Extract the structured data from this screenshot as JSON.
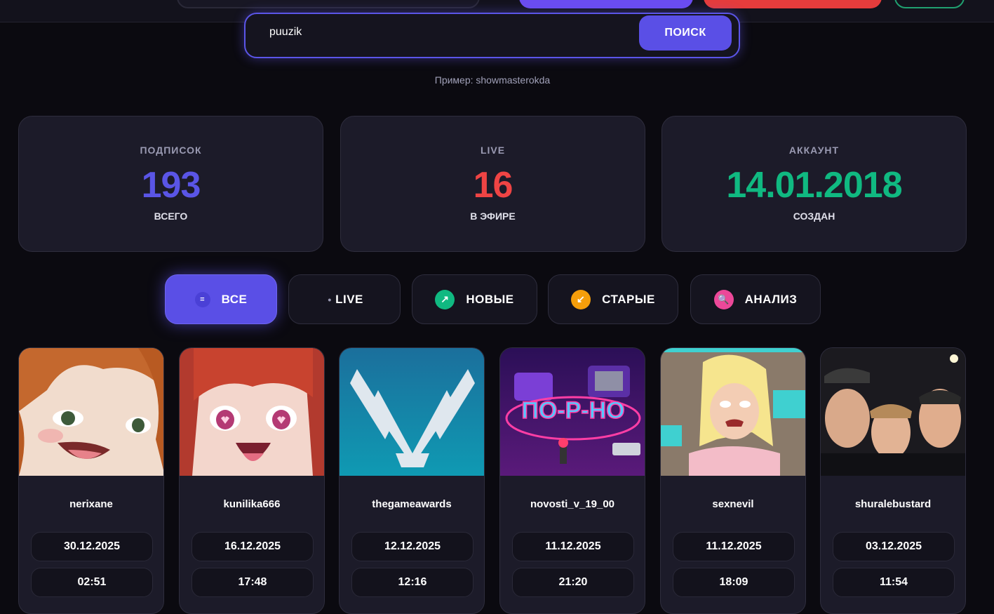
{
  "search": {
    "value": "puuzik",
    "button_label": "ПОИСК",
    "hint": "Пример: showmasterokda"
  },
  "stats": [
    {
      "label": "ПОДПИСОК",
      "value": "193",
      "sub": "ВСЕГО",
      "color": "#5a55e6"
    },
    {
      "label": "LIVE",
      "value": "16",
      "sub": "В ЭФИРЕ",
      "color": "#ef4444"
    },
    {
      "label": "АККАУНТ",
      "value": "14.01.2018",
      "sub": "СОЗДАН",
      "color": "#10b981"
    }
  ],
  "filters": [
    {
      "label": "ВСЕ",
      "icon": "equals-icon",
      "glyph": "=",
      "active": true
    },
    {
      "label": "LIVE",
      "icon": "dot-icon",
      "glyph": "•",
      "active": false
    },
    {
      "label": "НОВЫЕ",
      "icon": "arrow-up-right-icon",
      "glyph": "↗",
      "active": false,
      "icon_color": "#10b981"
    },
    {
      "label": "СТАРЫЕ",
      "icon": "arrow-down-left-icon",
      "glyph": "↙",
      "active": false,
      "icon_color": "#f59e0b"
    },
    {
      "label": "АНАЛИЗ",
      "icon": "magnifier-icon",
      "glyph": "🔍",
      "active": false,
      "icon_color": "#ec4899"
    }
  ],
  "channels": [
    {
      "name": "nerixane",
      "date": "30.12.2025",
      "time": "02:51"
    },
    {
      "name": "kunilika666",
      "date": "16.12.2025",
      "time": "17:48"
    },
    {
      "name": "thegameawards",
      "date": "12.12.2025",
      "time": "12:16"
    },
    {
      "name": "novosti_v_19_00",
      "date": "11.12.2025",
      "time": "21:20",
      "thumb_text": "ПО-Р-НО"
    },
    {
      "name": "sexnevil",
      "date": "11.12.2025",
      "time": "18:09"
    },
    {
      "name": "shuralebustard",
      "date": "03.12.2025",
      "time": "11:54"
    }
  ]
}
